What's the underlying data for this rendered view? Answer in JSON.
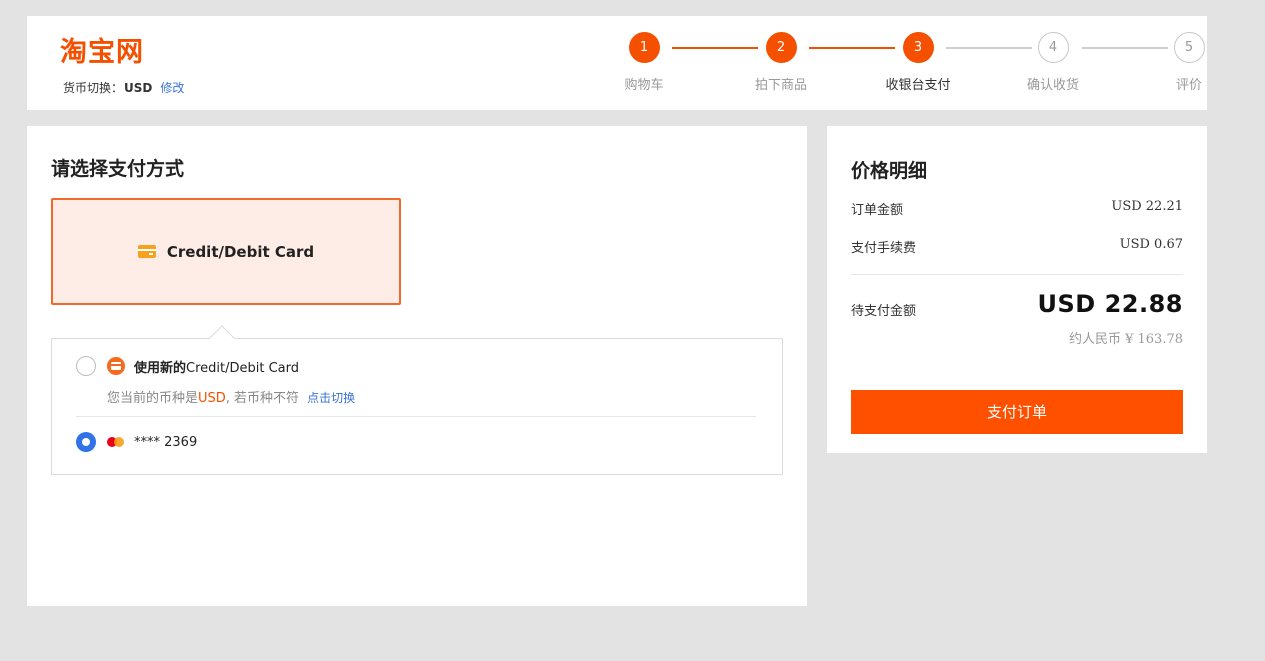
{
  "header": {
    "logo": "淘宝网",
    "currency_label": "货币切换：",
    "currency_code": "USD",
    "currency_edit": "修改"
  },
  "steps": [
    {
      "num": "1",
      "label": "购物车",
      "state": "done"
    },
    {
      "num": "2",
      "label": "拍下商品",
      "state": "done"
    },
    {
      "num": "3",
      "label": "收银台支付",
      "state": "current"
    },
    {
      "num": "4",
      "label": "确认收货",
      "state": "todo"
    },
    {
      "num": "5",
      "label": "评价",
      "state": "todo"
    }
  ],
  "main": {
    "title": "请选择支付方式",
    "method_card_label": "Credit/Debit Card",
    "option_new_bold": "使用新的",
    "option_new_rest": "Credit/Debit Card",
    "note_prefix": "您当前的币种是",
    "note_currency": "USD",
    "note_suffix": ", 若币种不符",
    "note_switch": "点击切换",
    "saved_card": "**** 2369"
  },
  "side": {
    "title": "价格明细",
    "order_amount_label": "订单金额",
    "order_amount_value": "USD 22.21",
    "fee_label": "支付手续费",
    "fee_value": "USD 0.67",
    "total_label": "待支付金额",
    "total_value": "USD 22.88",
    "rmb_value": "约人民币 ¥ 163.78",
    "pay_button": "支付订单"
  },
  "colors": {
    "accent": "#ff5000",
    "link": "#3a73d8",
    "radio_selected": "#2f73e6"
  }
}
